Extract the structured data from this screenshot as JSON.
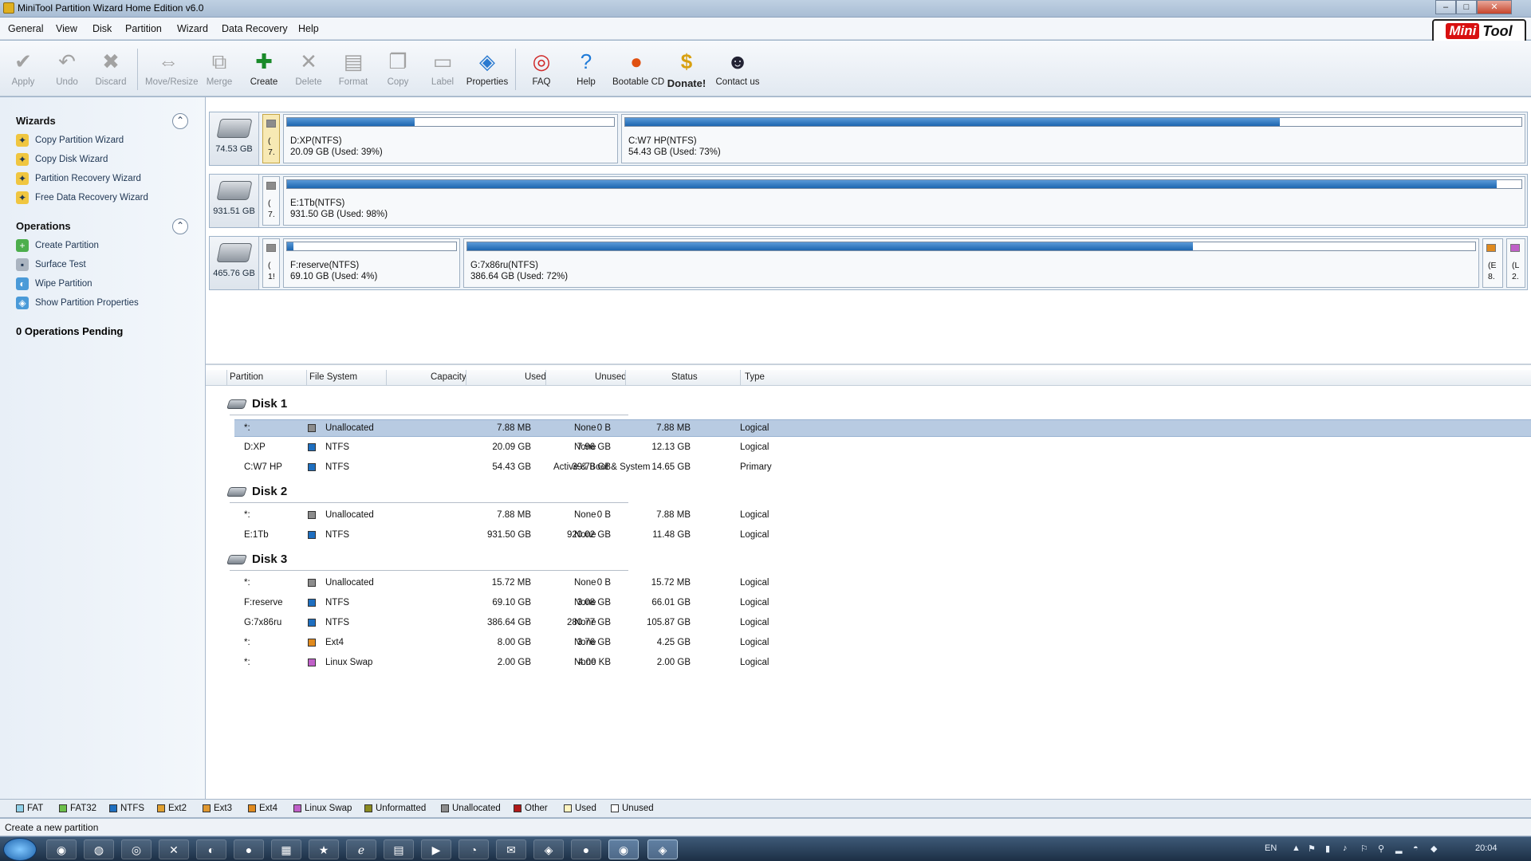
{
  "window": {
    "title": "MiniTool Partition Wizard Home Edition v6.0",
    "minimize": "–",
    "maximize": "□",
    "close": "✕"
  },
  "menu": [
    "General",
    "View",
    "Disk",
    "Partition",
    "Wizard",
    "Data Recovery",
    "Help"
  ],
  "logo": {
    "part1": "Mini",
    "part2": "Tool"
  },
  "toolbar": {
    "apply": "Apply",
    "undo": "Undo",
    "discard": "Discard",
    "move_resize": "Move/Resize",
    "merge": "Merge",
    "create": "Create",
    "delete": "Delete",
    "format": "Format",
    "copy": "Copy",
    "label": "Label",
    "properties": "Properties",
    "faq": "FAQ",
    "help": "Help",
    "bootable_cd": "Bootable CD",
    "donate": "Donate!",
    "contact_us": "Contact us"
  },
  "wizards": {
    "title": "Wizards",
    "items": [
      "Copy Partition Wizard",
      "Copy Disk Wizard",
      "Partition Recovery Wizard",
      "Free Data Recovery Wizard"
    ]
  },
  "operations": {
    "title": "Operations",
    "items": [
      "Create Partition",
      "Surface Test",
      "Wipe Partition",
      "Show Partition Properties"
    ]
  },
  "pending": "0 Operations Pending",
  "diskmap": [
    {
      "capacity": "74.53 GB",
      "small": [
        "(",
        "7."
      ],
      "parts": [
        {
          "name": "D:XP(NTFS)",
          "detail": "20.09 GB (Used: 39%)",
          "used": 0.39
        },
        {
          "name": "C:W7 HP(NTFS)",
          "detail": "54.43 GB (Used: 73%)",
          "used": 0.73
        }
      ]
    },
    {
      "capacity": "931.51 GB",
      "small": [
        "(",
        "7."
      ],
      "parts": [
        {
          "name": "E:1Tb(NTFS)",
          "detail": "931.50 GB (Used: 98%)",
          "used": 0.98
        }
      ]
    },
    {
      "capacity": "465.76 GB",
      "small": [
        "(",
        "1!"
      ],
      "parts": [
        {
          "name": "F:reserve(NTFS)",
          "detail": "69.10 GB (Used: 4%)",
          "used": 0.04
        },
        {
          "name": "G:7x86ru(NTFS)",
          "detail": "386.64 GB (Used: 72%)",
          "used": 0.72
        }
      ],
      "tail": [
        [
          "(E",
          "8."
        ],
        [
          "(L",
          "2."
        ]
      ]
    }
  ],
  "columns": [
    "Partition",
    "File System",
    "Capacity",
    "Used",
    "Unused",
    "Status",
    "Type"
  ],
  "disks": [
    {
      "name": "Disk 1",
      "rows": [
        {
          "partition": "*:",
          "fs": "Unallocated",
          "capacity": "7.88 MB",
          "used": "0 B",
          "unused": "7.88 MB",
          "status": "None",
          "type": "Logical",
          "color": "#8c8c8c"
        },
        {
          "partition": "D:XP",
          "fs": "NTFS",
          "capacity": "20.09 GB",
          "used": "7.96 GB",
          "unused": "12.13 GB",
          "status": "None",
          "type": "Logical",
          "color": "#1e6fc0"
        },
        {
          "partition": "C:W7 HP",
          "fs": "NTFS",
          "capacity": "54.43 GB",
          "used": "39.78 GB",
          "unused": "14.65 GB",
          "status": "Active & Boot & System",
          "type": "Primary",
          "color": "#1e6fc0"
        }
      ]
    },
    {
      "name": "Disk 2",
      "rows": [
        {
          "partition": "*:",
          "fs": "Unallocated",
          "capacity": "7.88 MB",
          "used": "0 B",
          "unused": "7.88 MB",
          "status": "None",
          "type": "Logical",
          "color": "#8c8c8c"
        },
        {
          "partition": "E:1Tb",
          "fs": "NTFS",
          "capacity": "931.50 GB",
          "used": "920.02 GB",
          "unused": "11.48 GB",
          "status": "None",
          "type": "Logical",
          "color": "#1e6fc0"
        }
      ]
    },
    {
      "name": "Disk 3",
      "rows": [
        {
          "partition": "*:",
          "fs": "Unallocated",
          "capacity": "15.72 MB",
          "used": "0 B",
          "unused": "15.72 MB",
          "status": "None",
          "type": "Logical",
          "color": "#8c8c8c"
        },
        {
          "partition": "F:reserve",
          "fs": "NTFS",
          "capacity": "69.10 GB",
          "used": "3.08 GB",
          "unused": "66.01 GB",
          "status": "None",
          "type": "Logical",
          "color": "#1e6fc0"
        },
        {
          "partition": "G:7x86ru",
          "fs": "NTFS",
          "capacity": "386.64 GB",
          "used": "280.77 GB",
          "unused": "105.87 GB",
          "status": "None",
          "type": "Logical",
          "color": "#1e6fc0"
        },
        {
          "partition": "*:",
          "fs": "Ext4",
          "capacity": "8.00 GB",
          "used": "3.76 GB",
          "unused": "4.25 GB",
          "status": "None",
          "type": "Logical",
          "color": "#e08a1e"
        },
        {
          "partition": "*:",
          "fs": "Linux Swap",
          "capacity": "2.00 GB",
          "used": "4.00 KB",
          "unused": "2.00 GB",
          "status": "None",
          "type": "Logical",
          "color": "#c060c8"
        }
      ]
    }
  ],
  "legend": [
    {
      "label": "FAT",
      "color": "#8fd0e8"
    },
    {
      "label": "FAT32",
      "color": "#6cc04a"
    },
    {
      "label": "NTFS",
      "color": "#1e6fc0"
    },
    {
      "label": "Ext2",
      "color": "#e0a030"
    },
    {
      "label": "Ext3",
      "color": "#e09830"
    },
    {
      "label": "Ext4",
      "color": "#e08a1e"
    },
    {
      "label": "Linux Swap",
      "color": "#c060c8"
    },
    {
      "label": "Unformatted",
      "color": "#8a8a20"
    },
    {
      "label": "Unallocated",
      "color": "#8c8c8c"
    },
    {
      "label": "Other",
      "color": "#b01818"
    },
    {
      "label": "Used",
      "color": "#fff4c0"
    },
    {
      "label": "Unused",
      "color": "#ffffff"
    }
  ],
  "status_text": "Create a new partition",
  "tray": {
    "lang": "EN",
    "time": "20:04"
  }
}
